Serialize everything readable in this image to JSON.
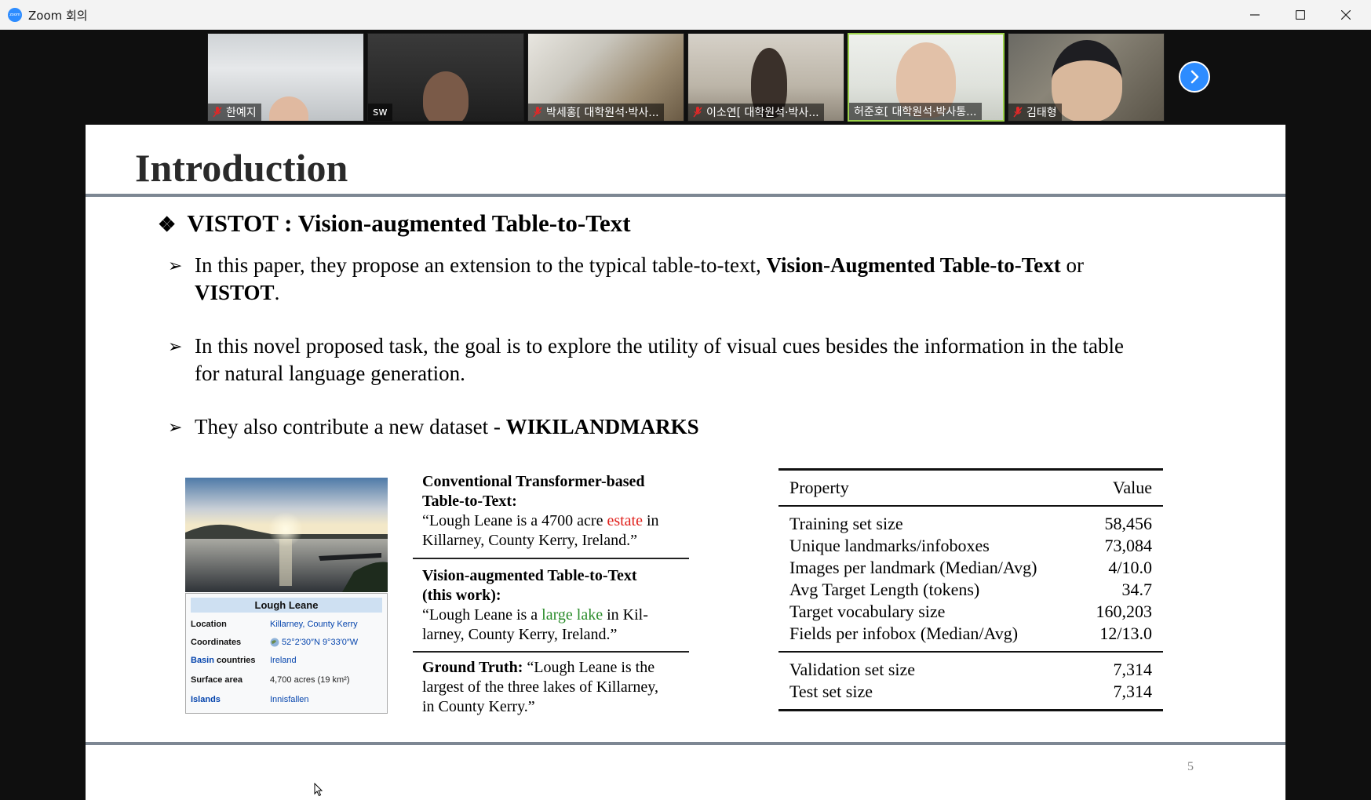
{
  "window": {
    "title": "Zoom 회의",
    "app_icon_text": "zoom"
  },
  "participants": [
    {
      "name": "한예지",
      "muted": true
    },
    {
      "name": "sw",
      "muted": false
    },
    {
      "name": "박세홍[ 대학원석·박사...",
      "muted": true
    },
    {
      "name": "이소연[ 대학원석·박사...",
      "muted": true
    },
    {
      "name": "허준호[ 대학원석·박사통...",
      "muted": false,
      "active_speaker": true
    },
    {
      "name": "김태형",
      "muted": true
    }
  ],
  "slide": {
    "title": "Introduction",
    "heading_symbol": "❖",
    "heading": "VISTOT : Vision-augmented Table-to-Text",
    "bullet_symbol": "➢",
    "bullets": [
      {
        "pre": "In this paper, they propose an extension to the typical table-to-text, ",
        "bold": "Vision-Augmented Table-to-Text",
        "mid": " or",
        "line2_bold": "VISTOT",
        "line2_post": "."
      },
      {
        "line1": "In this novel proposed task, the goal is to explore the utility of visual cues besides the information in the table",
        "line2": "for natural language generation."
      },
      {
        "pre": "They also contribute a new dataset - ",
        "bold": "WIKILANDMARKS"
      }
    ],
    "infobox": {
      "title": "Lough Leane",
      "rows": [
        {
          "key": "Location",
          "value": "Killarney, County Kerry"
        },
        {
          "key": "Coordinates",
          "value": "52°2′30″N 9°33′0″W"
        },
        {
          "key_link": "Basin",
          "key_rest": " countries",
          "value": "Ireland"
        },
        {
          "key": "Surface area",
          "value": "4,700 acres (19 km²)"
        },
        {
          "key_link": "Islands",
          "value": "Innisfallen"
        }
      ]
    },
    "comparison": {
      "conv_title_1": "Conventional  Transformer-based",
      "conv_title_2": "Table-to-Text:",
      "conv_pre": "“Lough Leane is a 4700 acre ",
      "conv_highlight": "estate",
      "conv_post_1": " in",
      "conv_post_2": "Killarney, County Kerry, Ireland.”",
      "vis_title_1": "Vision-augmented    Table-to-Text",
      "vis_title_2": "(this work):",
      "vis_pre": "“Lough Leane is a ",
      "vis_highlight": "large lake",
      "vis_post_1": " in Kil-",
      "vis_post_2": "larney, County Kerry, Ireland.”",
      "gt_label": "Ground Truth:",
      "gt_text_1": " “Lough Leane is the",
      "gt_text_2": "largest of the three lakes of Killarney,",
      "gt_text_3": "in County Kerry.”"
    },
    "table": {
      "header": [
        "Property",
        "Value"
      ],
      "group1": [
        [
          "Training set size",
          "58,456"
        ],
        [
          "Unique landmarks/infoboxes",
          "73,084"
        ],
        [
          "Images per landmark (Median/Avg)",
          "4/10.0"
        ],
        [
          "Avg Target Length (tokens)",
          "34.7"
        ],
        [
          "Target vocabulary size",
          "160,203"
        ],
        [
          "Fields per infobox (Median/Avg)",
          "12/13.0"
        ]
      ],
      "group2": [
        [
          "Validation set size",
          "7,314"
        ],
        [
          "Test set size",
          "7,314"
        ]
      ]
    },
    "page_number": "5"
  },
  "colors": {
    "zoom_blue": "#2d8cff",
    "active_speaker_border": "#9bd14a",
    "rule_gray": "#7d8793",
    "highlight_red": "#e0201b",
    "highlight_green": "#2a8c2a"
  }
}
